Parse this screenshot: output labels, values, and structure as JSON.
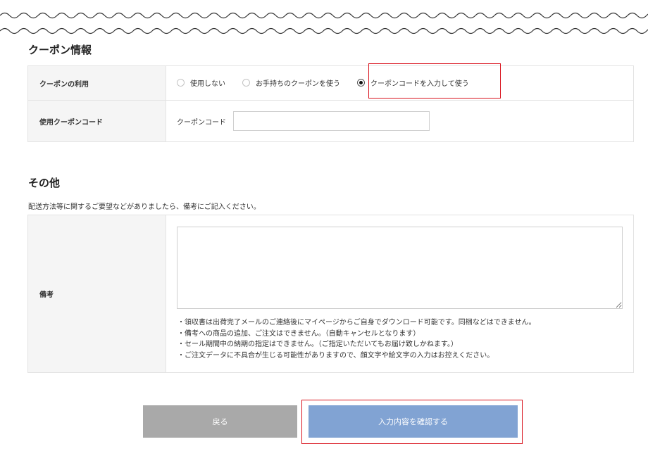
{
  "coupon_section": {
    "title": "クーポン情報",
    "usage": {
      "label": "クーポンの利用",
      "options": [
        {
          "label": "使用しない",
          "selected": false
        },
        {
          "label": "お手持ちのクーポンを使う",
          "selected": false
        },
        {
          "label": "クーポンコードを入力して使う",
          "selected": true
        }
      ]
    },
    "code_row": {
      "label": "使用クーポンコード",
      "field_label": "クーポンコード",
      "value": ""
    }
  },
  "other_section": {
    "title": "その他",
    "description": "配送方法等に関するご要望などがありましたら、備考にご記入ください。",
    "remarks": {
      "label": "備考",
      "value": "",
      "notes": [
        "・領収書は出荷完了メールのご連絡後にマイページからご自身でダウンロード可能です。同梱などはできません。",
        "・備考への商品の追加、ご注文はできません。（自動キャンセルとなります）",
        "・セール期間中の納期の指定はできません。（ご指定いただいてもお届け致しかねます。）",
        "・ご注文データに不具合が生じる可能性がありますので、顔文字や絵文字の入力はお控えください。"
      ]
    }
  },
  "buttons": {
    "back_label": "戻る",
    "confirm_label": "入力内容を確認する"
  },
  "colors": {
    "highlight": "#d9141e",
    "confirm_button": "#81a3d3",
    "back_button": "#a9a9a9",
    "label_background": "#f5f5f5"
  }
}
